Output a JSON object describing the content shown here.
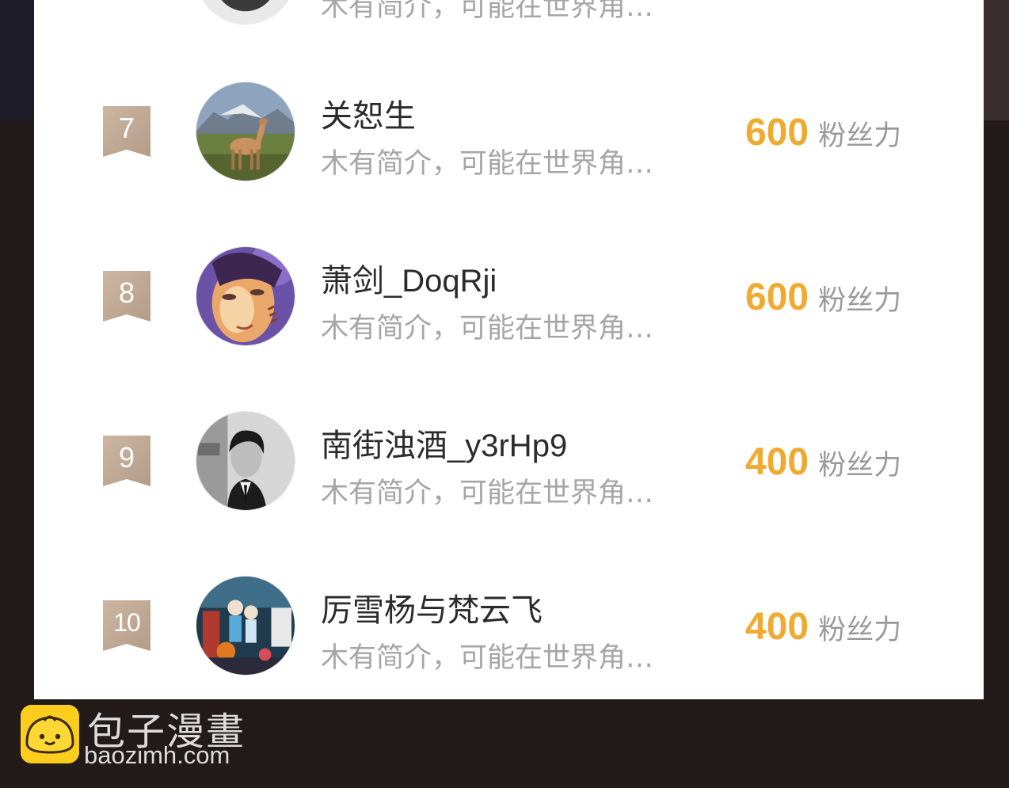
{
  "ranking": {
    "partial_row": {
      "desc": "木有简介，可能在世界角…"
    },
    "rows": [
      {
        "rank": "7",
        "name": "关恕生",
        "desc": "木有简介，可能在世界角…",
        "score": "600",
        "unit": "粉丝力"
      },
      {
        "rank": "8",
        "name": "萧剑_DoqRji",
        "desc": "木有简介，可能在世界角…",
        "score": "600",
        "unit": "粉丝力"
      },
      {
        "rank": "9",
        "name": "南街浊酒_y3rHp9",
        "desc": "木有简介，可能在世界角…",
        "score": "400",
        "unit": "粉丝力"
      },
      {
        "rank": "10",
        "name": "厉雪杨与梵云飞",
        "desc": "木有简介，可能在世界角…",
        "score": "400",
        "unit": "粉丝力"
      }
    ]
  },
  "watermark": {
    "name": "包子漫畫",
    "url": "baozimh.com"
  },
  "colors": {
    "accent": "#efab31",
    "rank_badge": "#c3ac97",
    "name_text": "#2b2b2b",
    "muted_text": "#a6a6a6",
    "logo_yellow": "#fccd1d"
  },
  "icons": [
    "rank-badge-icon",
    "bun-logo-icon"
  ]
}
